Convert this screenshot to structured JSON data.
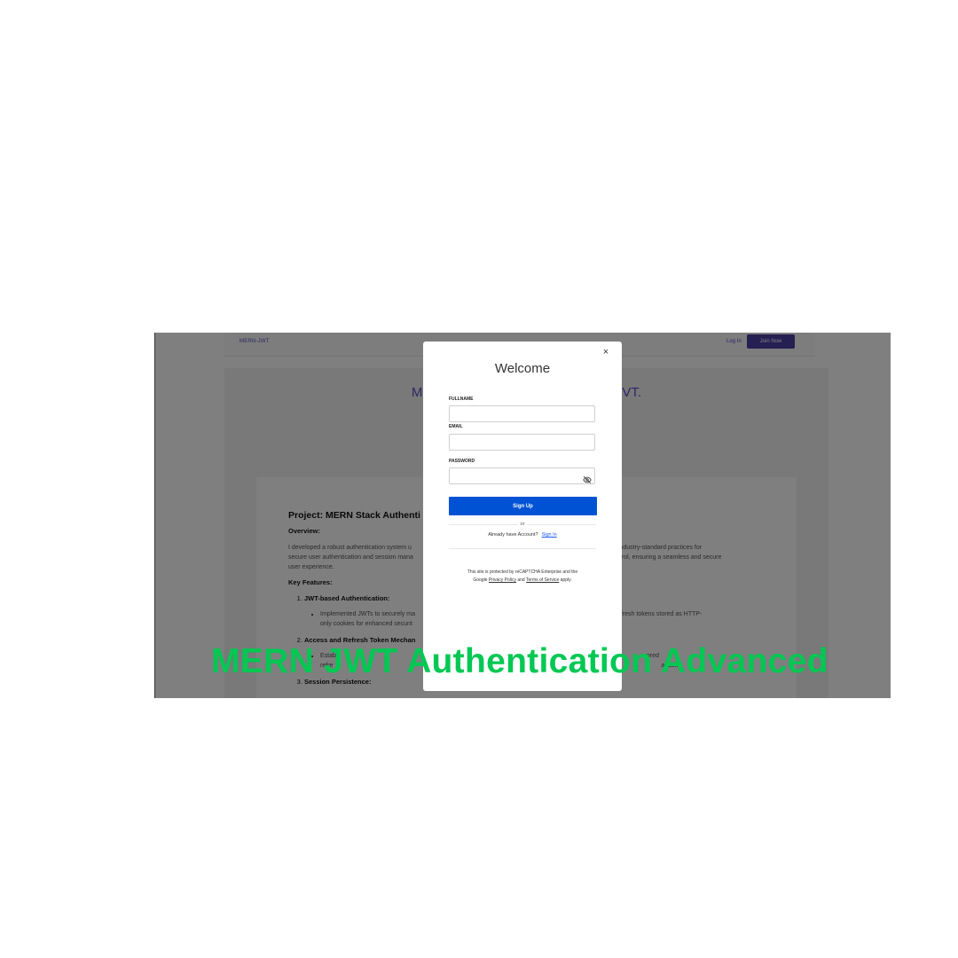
{
  "navbar": {
    "brand": "MERN-JWT",
    "login_label": "Log In",
    "join_label": "Join Now"
  },
  "hero": {
    "title_left": "M",
    "title_right": "VT."
  },
  "content": {
    "project_title": "Project: MERN Stack Authenti",
    "overview_heading": "Overview:",
    "overview_text_left": "I developed a robust authentication system u",
    "overview_text_mid": "secure user authentication and session mana",
    "overview_text_end": "user experience.",
    "overview_text_right_1": "s, implementing industry-standard practices for",
    "overview_text_right_2": "ess control, ensuring a seamless and secure",
    "key_features_heading": "Key Features:",
    "features": [
      {
        "title": "JWT-based Authentication:",
        "detail_left": "Implemented JWTs to securely ma",
        "detail_left_2": "only cookies for enhanced securit",
        "detail_right": "ntication and refresh tokens stored as HTTP-"
      },
      {
        "title": "Access and Refresh Token Mechan",
        "detail_left": "Estab",
        "detail_left_2": "refre",
        "detail_right": "ored",
        "detail_right_2": "attacks."
      },
      {
        "title": "Session Persistence:"
      }
    ]
  },
  "modal": {
    "close_symbol": "×",
    "title": "Welcome",
    "fullname_label": "FULLNAME",
    "fullname_value": "",
    "email_label": "EMAIL",
    "email_value": "",
    "password_label": "PASSWORD",
    "password_value": "",
    "password_icon": "eye-off-icon",
    "signup_label": "Sign Up",
    "or_text": "or",
    "have_account_text": "Already have Account?",
    "signin_label": "Sign In",
    "recaptcha_text_1": "This site is protected by reCAPTCHA Enterprise and the",
    "recaptcha_text_2": "Google",
    "privacy_link": "Privacy Policy",
    "and_text": "and",
    "terms_link": "Terms of Service",
    "apply_text": "apply."
  },
  "watermark": {
    "text": "MERN JWT Authentication Advanced"
  },
  "colors": {
    "brand_purple": "#4d3fa4",
    "signup_blue": "#0052d4",
    "watermark_green": "#00c853"
  }
}
